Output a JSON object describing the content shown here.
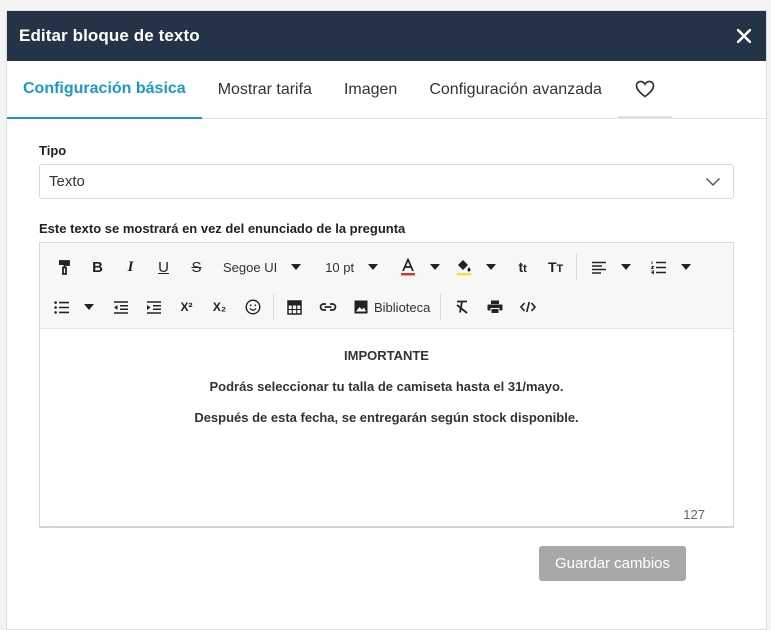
{
  "modal": {
    "title": "Editar bloque de texto",
    "close_icon": "close-icon"
  },
  "tabs": [
    {
      "label": "Configuración básica",
      "active": true
    },
    {
      "label": "Mostrar tarifa",
      "active": false
    },
    {
      "label": "Imagen",
      "active": false
    },
    {
      "label": "Configuración avanzada",
      "active": false
    },
    {
      "icon": "heart-icon",
      "active": false
    }
  ],
  "tipo": {
    "label": "Tipo",
    "value": "Texto",
    "icon": "chevron-down-icon"
  },
  "editor": {
    "label": "Este texto se mostrará en vez del enunciado de la pregunta",
    "font_family": "Segoe UI",
    "font_size": "10 pt",
    "library_label": "Biblioteca",
    "superscript_label": "X²",
    "subscript_label": "X₂",
    "lines": [
      "IMPORTANTE",
      "Podrás seleccionar tu talla de camiseta hasta el 31/mayo.",
      "Después de esta fecha, se entregarán según stock disponible."
    ],
    "char_count": "127"
  },
  "footer": {
    "save_label": "Guardar cambios"
  },
  "colors": {
    "header_bg": "#253346",
    "accent": "#1a9bc4",
    "save_disabled": "#a8a8a8"
  }
}
